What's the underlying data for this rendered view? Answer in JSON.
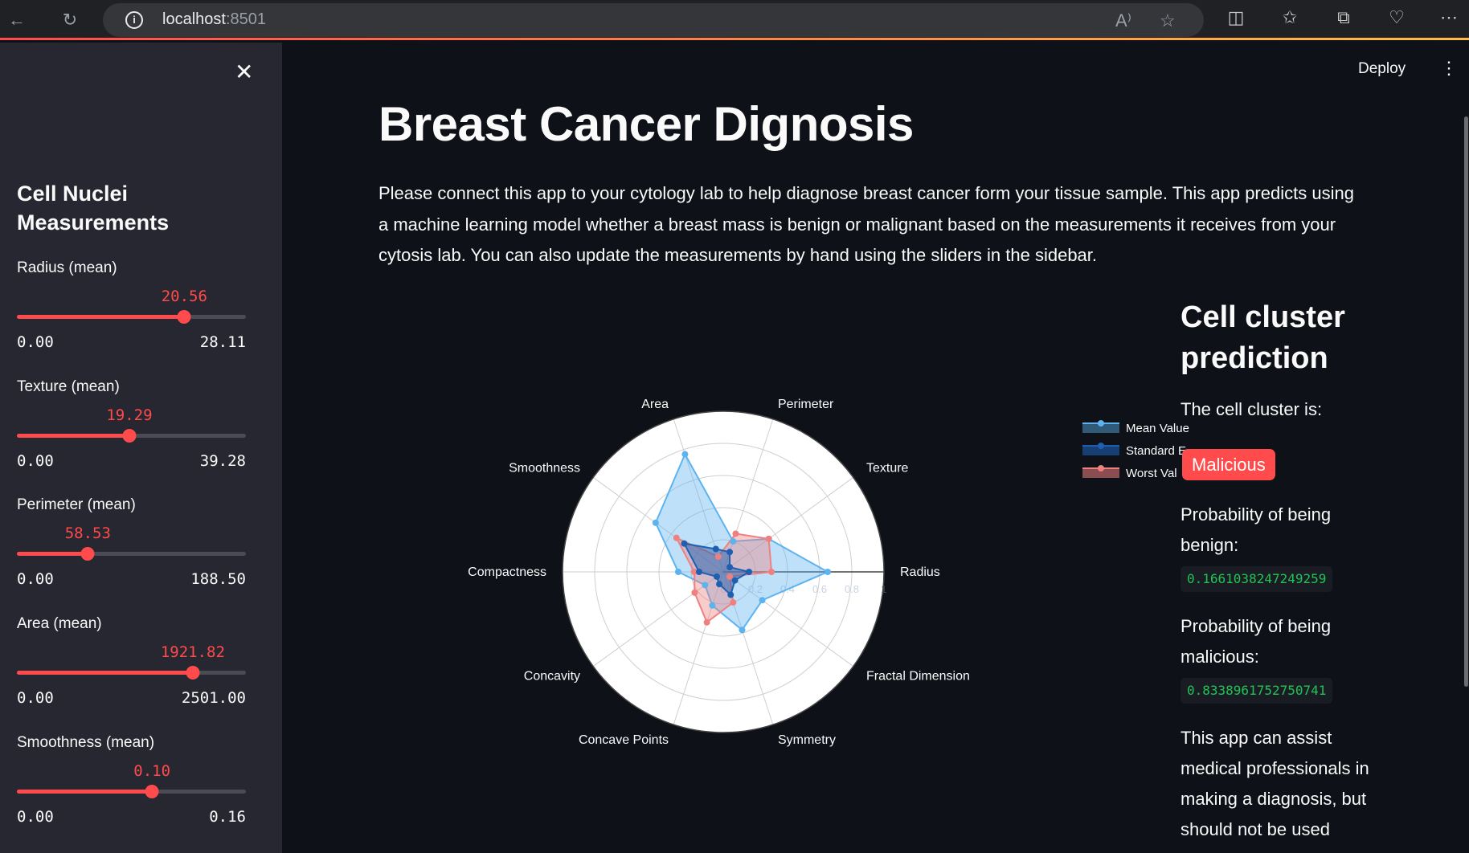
{
  "browser": {
    "host": "localhost",
    "port": ":8501",
    "icons": [
      "back-icon",
      "reload-icon",
      "info-icon",
      "read-aloud-icon",
      "favorite-star-icon",
      "split-screen-icon",
      "favorites-icon",
      "collections-icon",
      "health-icon",
      "more-icon"
    ]
  },
  "sidebar": {
    "close_icon": "✕",
    "title": "Cell Nuclei Measurements",
    "sliders": [
      {
        "label": "Radius (mean)",
        "value": "20.56",
        "min": "0.00",
        "max": "28.11",
        "fraction": 0.731
      },
      {
        "label": "Texture (mean)",
        "value": "19.29",
        "min": "0.00",
        "max": "39.28",
        "fraction": 0.491
      },
      {
        "label": "Perimeter (mean)",
        "value": "58.53",
        "min": "0.00",
        "max": "188.50",
        "fraction": 0.31
      },
      {
        "label": "Area (mean)",
        "value": "1921.82",
        "min": "0.00",
        "max": "2501.00",
        "fraction": 0.768
      },
      {
        "label": "Smoothness (mean)",
        "value": "0.10",
        "min": "0.00",
        "max": "0.16",
        "fraction": 0.59
      }
    ]
  },
  "header": {
    "deploy_label": "Deploy",
    "menu_icon": "⋮"
  },
  "main": {
    "title": "Breast Cancer Dignosis",
    "intro": "Please connect this app to your cytology lab to help diagnose breast cancer form your tissue sample. This app predicts using a machine learning model whether a breast mass is benign or malignant based on the measurements it receives from your cytosis lab. You can also update the measurements by hand using the sliders in the sidebar."
  },
  "prediction": {
    "heading": "Cell cluster prediction",
    "cluster_label": "The cell cluster is:",
    "result": "Malicious",
    "benign_label": "Probability of being benign:",
    "benign_value": "0.1661038247249259",
    "malicious_label": "Probability of being malicious:",
    "malicious_value": "0.8338961752750741",
    "disclaimer": "This app can assist medical professionals in making a diagnosis, but should not be used"
  },
  "chart_data": {
    "type": "radar",
    "categories": [
      "Radius",
      "Texture",
      "Perimeter",
      "Area",
      "Smoothness",
      "Compactness",
      "Concavity",
      "Concave Points",
      "Symmetry",
      "Fractal Dimension"
    ],
    "radial_ticks": [
      "0",
      "0.2",
      "0.4",
      "0.6",
      "0.8",
      "1"
    ],
    "radial_range": [
      0,
      1
    ],
    "series": [
      {
        "name": "Mean Value",
        "color": "#5cb3f0",
        "values": [
          0.65,
          0.35,
          0.2,
          0.77,
          0.52,
          0.28,
          0.14,
          0.22,
          0.38,
          0.3
        ]
      },
      {
        "name": "Standard Error",
        "color": "#1f5fb0",
        "values": [
          0.16,
          0.05,
          0.13,
          0.15,
          0.3,
          0.15,
          0.05,
          0.08,
          0.15,
          0.09
        ]
      },
      {
        "name": "Worst Value",
        "color": "#f08080",
        "values": [
          0.3,
          0.35,
          0.25,
          0.1,
          0.36,
          0.18,
          0.22,
          0.33,
          0.2,
          0.05
        ]
      }
    ],
    "legend": [
      "Mean Value",
      "Standard E",
      "Worst Val"
    ],
    "legend_position": "right"
  }
}
